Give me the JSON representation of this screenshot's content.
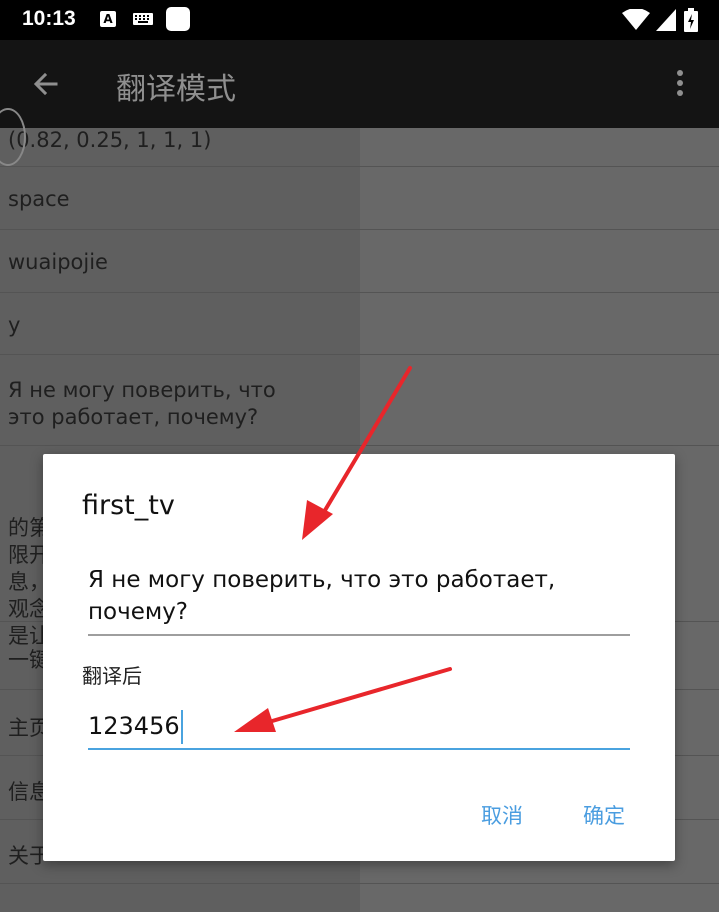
{
  "status_bar": {
    "time": "10:13",
    "icons": [
      "a-notification-icon",
      "keyboard-icon",
      "square-notification-icon",
      "wifi-icon",
      "signal-icon",
      "battery-icon"
    ],
    "a_glyph": "A"
  },
  "app_bar": {
    "title": "翻译模式",
    "back_icon": "arrow-left-icon",
    "menu_icon": "more-vert-icon"
  },
  "list": {
    "items": [
      {
        "text": "(0.82, 0.25, 1, 1, 1)"
      },
      {
        "text": "space"
      },
      {
        "text": "wuaipojie"
      },
      {
        "text": "y"
      },
      {
        "text": "Я не могу поверить, что это работает, почему?"
      },
      {
        "text": "的第\n限开\n息，\n观念\n是让"
      },
      {
        "text": "一键"
      },
      {
        "text": "主页"
      },
      {
        "text": "信息"
      },
      {
        "text": "关于"
      }
    ]
  },
  "dialog": {
    "title": "first_tv",
    "original_text": "Я не могу поверить, что это работает, почему?",
    "translated_label": "翻译后",
    "translated_value": "123456",
    "cancel_label": "取消",
    "ok_label": "确定"
  },
  "colors": {
    "accent": "#4a9de0",
    "annotation_arrow": "#e8262b",
    "dim_background": "#5f5f5f"
  }
}
